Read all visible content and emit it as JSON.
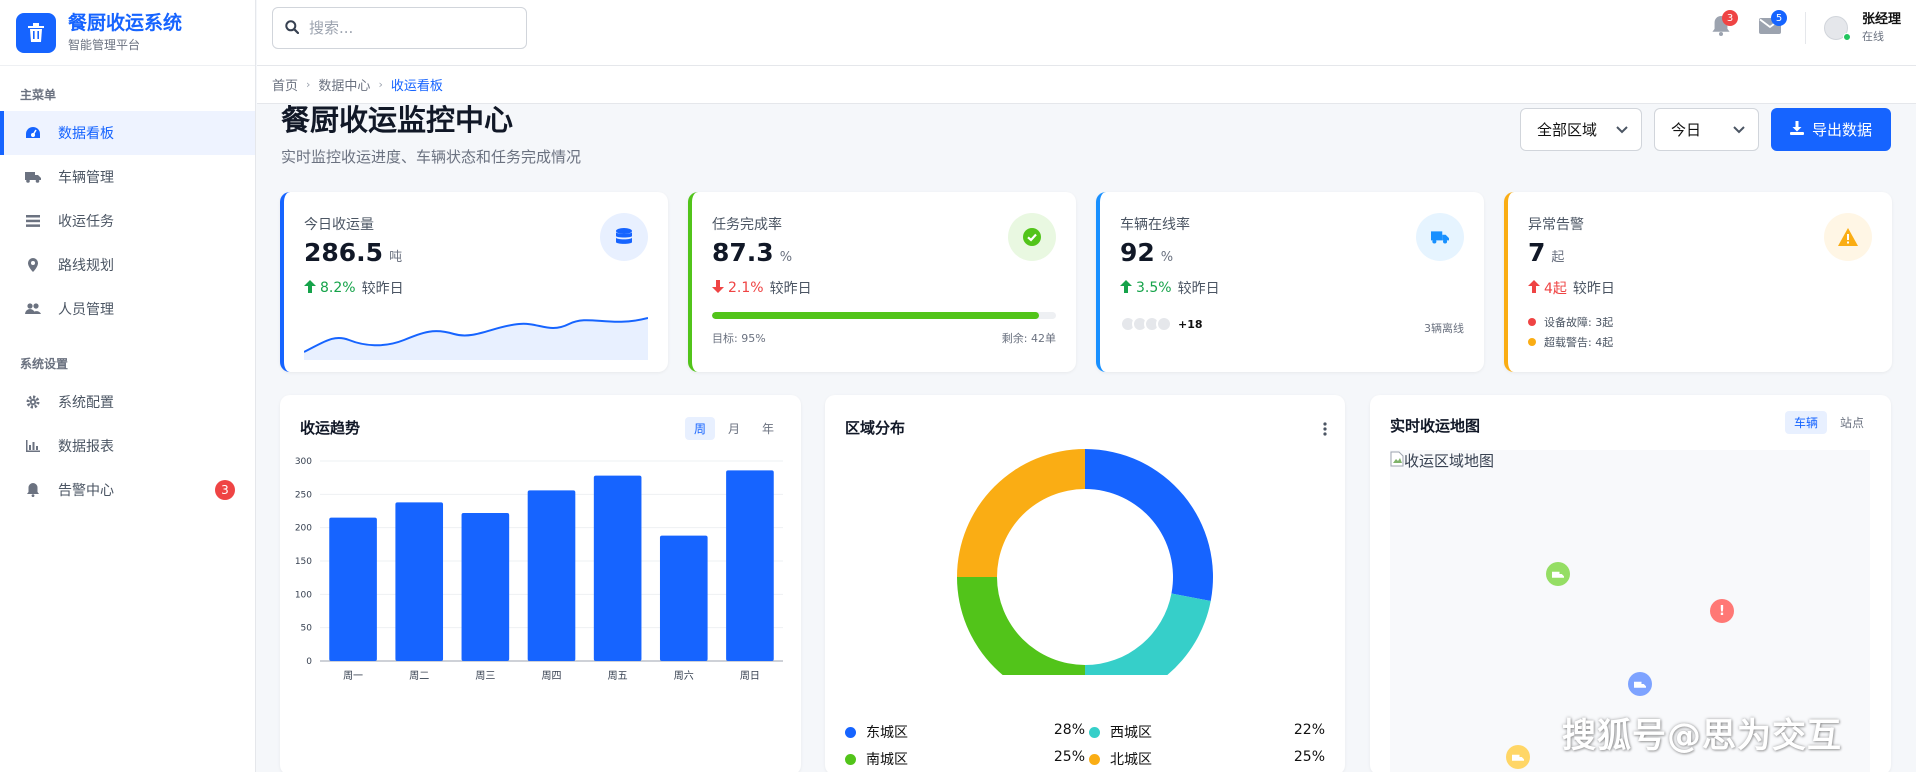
{
  "brand": {
    "title": "餐厨收运系统",
    "subtitle": "智能管理平台",
    "logo_icon": "trash-icon"
  },
  "sidebar": {
    "section_main": "主菜单",
    "main_items": [
      {
        "label": "数据看板",
        "icon": "dashboard-icon",
        "active": true
      },
      {
        "label": "车辆管理",
        "icon": "truck-icon"
      },
      {
        "label": "收运任务",
        "icon": "tasks-icon"
      },
      {
        "label": "路线规划",
        "icon": "location-pin-icon"
      },
      {
        "label": "人员管理",
        "icon": "users-icon"
      }
    ],
    "section_system": "系统设置",
    "system_items": [
      {
        "label": "系统配置",
        "icon": "gear-icon"
      },
      {
        "label": "数据报表",
        "icon": "bar-chart-icon"
      },
      {
        "label": "告警中心",
        "icon": "bell-icon",
        "badge": "3"
      }
    ]
  },
  "header": {
    "search_placeholder": "搜索...",
    "notifications_count": "3",
    "messages_count": "5",
    "user_name": "张经理",
    "user_status": "在线"
  },
  "breadcrumb": [
    "首页",
    "数据中心",
    "收运看板"
  ],
  "page": {
    "title": "餐厨收运监控中心",
    "subtitle": "实时监控收运进度、车辆状态和任务完成情况",
    "region_select": "全部区域",
    "date_select": "今日",
    "export_label": "导出数据"
  },
  "stats": [
    {
      "label": "今日收运量",
      "value": "286.5",
      "unit": "吨",
      "trend": "8.2%",
      "trend_dir": "up",
      "trend_text": "较昨日",
      "accent": "#1664ff",
      "icon": "database-icon"
    },
    {
      "label": "任务完成率",
      "value": "87.3",
      "unit": "%",
      "trend": "2.1%",
      "trend_dir": "down",
      "trend_text": "较昨日",
      "accent": "#52c41a",
      "icon": "check-circle-icon",
      "progress": 0.95,
      "target": "目标: 95%",
      "remaining": "剩余: 42单"
    },
    {
      "label": "车辆在线率",
      "value": "92",
      "unit": "%",
      "trend": "3.5%",
      "trend_dir": "up",
      "trend_text": "较昨日",
      "accent": "#1890ff",
      "icon": "truck-icon",
      "more": "+18",
      "offline": "3辆离线"
    },
    {
      "label": "异常告警",
      "value": "7",
      "unit": "起",
      "trend": "4起",
      "trend_dir": "up-red",
      "trend_text": "较昨日",
      "accent": "#faad14",
      "icon": "warning-icon",
      "alert_lines": [
        "设备故障: 3起",
        "超载警告: 4起"
      ]
    }
  ],
  "trend_panel": {
    "title": "收运趋势",
    "tabs": [
      "周",
      "月",
      "年"
    ]
  },
  "region_panel": {
    "title": "区域分布",
    "legend": [
      {
        "name": "东城区",
        "value": "28%",
        "color": "#1664ff"
      },
      {
        "name": "西城区",
        "value": "22%",
        "color": "#36cfc9"
      },
      {
        "name": "南城区",
        "value": "25%",
        "color": "#52c41a"
      },
      {
        "name": "北城区",
        "value": "25%",
        "color": "#faad14"
      }
    ]
  },
  "map_panel": {
    "title": "实时收运地图",
    "tabs": [
      "车辆",
      "站点"
    ],
    "image_alt": "收运区域地图"
  },
  "watermark": "搜狐号@思为交互",
  "chart_data": [
    {
      "type": "bar",
      "title": "收运趋势",
      "categories": [
        "周一",
        "周二",
        "周三",
        "周四",
        "周五",
        "周六",
        "周日"
      ],
      "values": [
        215,
        238,
        222,
        256,
        278,
        188,
        286
      ],
      "ylim": [
        0,
        300
      ],
      "yticks": [
        0,
        50,
        100,
        150,
        200,
        250,
        300
      ],
      "color": "#1664ff",
      "grid": true
    },
    {
      "type": "pie",
      "title": "区域分布",
      "labels": [
        "东城区",
        "西城区",
        "南城区",
        "北城区"
      ],
      "values": [
        28,
        22,
        25,
        25
      ],
      "colors": [
        "#1664ff",
        "#36cfc9",
        "#52c41a",
        "#faad14"
      ],
      "donut": true
    }
  ]
}
